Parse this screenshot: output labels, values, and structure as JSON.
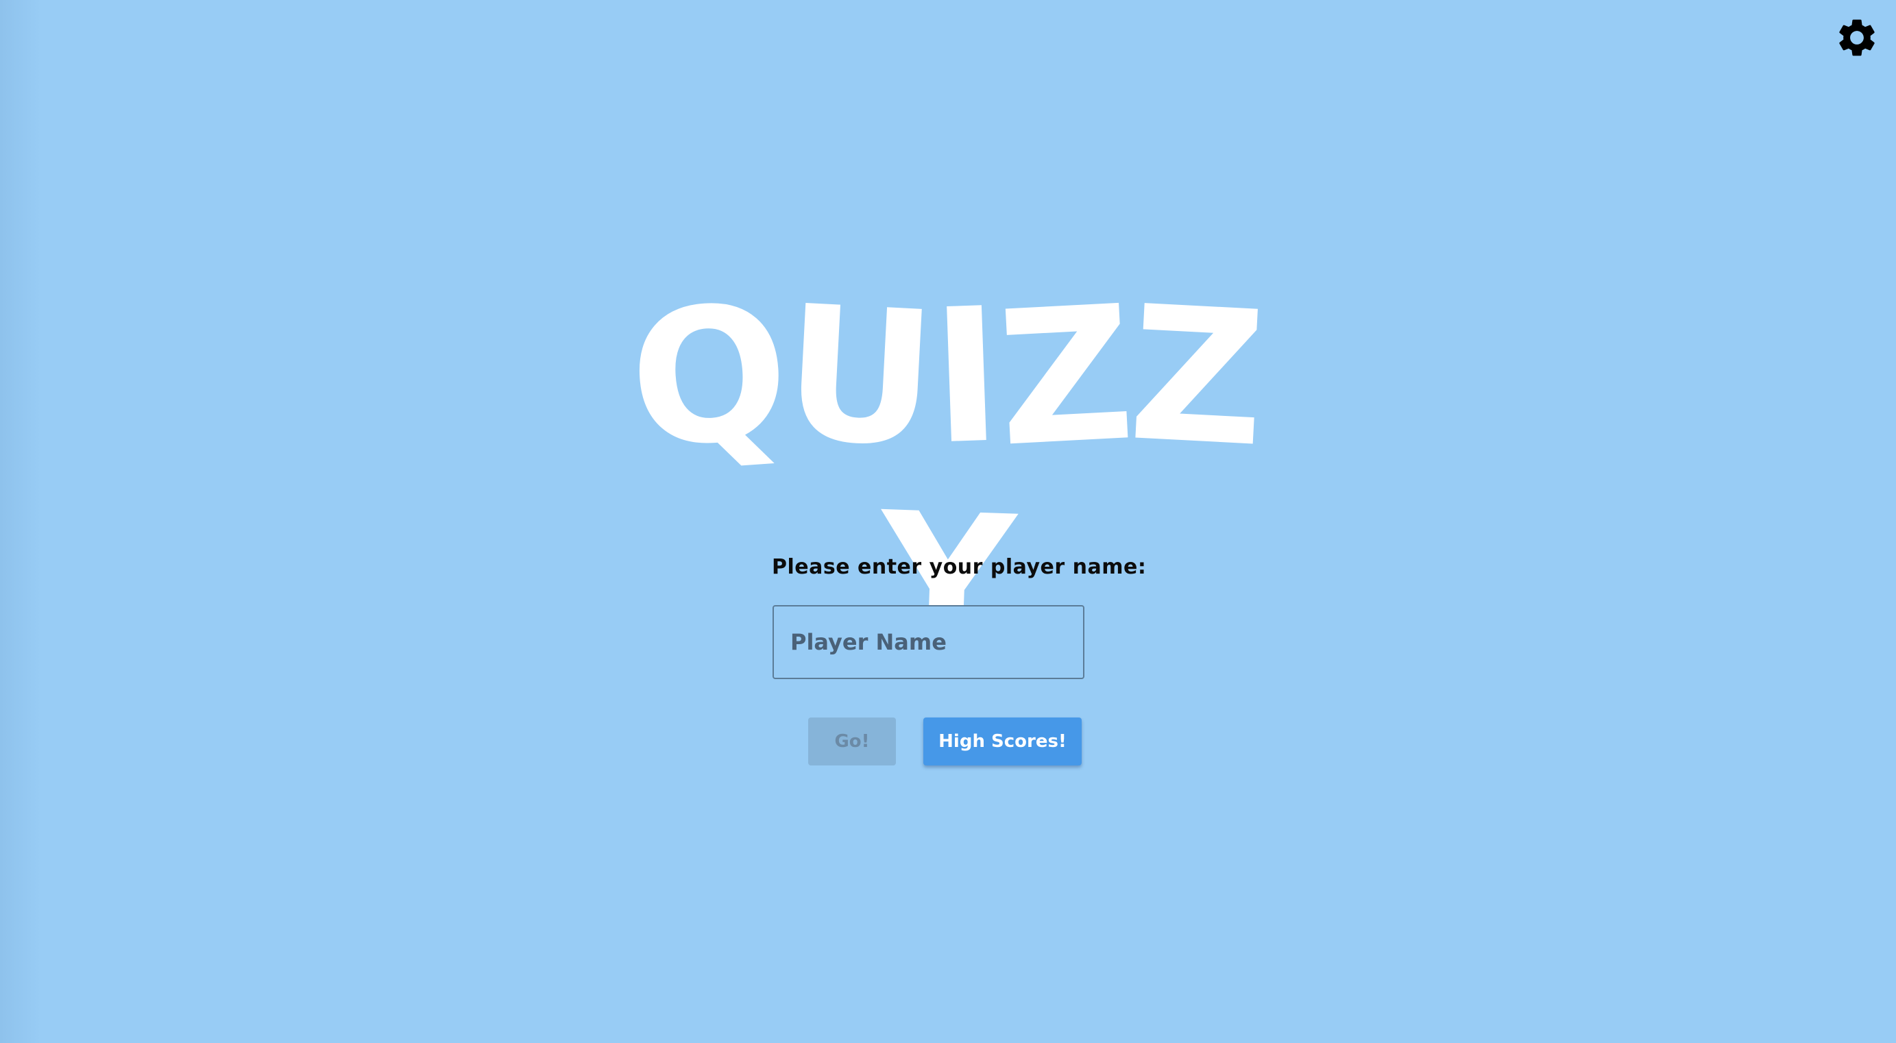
{
  "app": {
    "title_letters": [
      "Q",
      "U",
      "I",
      "Z",
      "Z",
      "Y"
    ]
  },
  "header": {
    "settings_icon": "gear-icon"
  },
  "form": {
    "prompt": "Please enter your player name:",
    "player_name": {
      "value": "",
      "placeholder": "Player Name"
    }
  },
  "actions": {
    "go_label": "Go!",
    "go_disabled": true,
    "high_scores_label": "High Scores!"
  },
  "colors": {
    "background": "#98ccf5",
    "primary_button": "#4698e8",
    "disabled_button": "#86b4d9",
    "title": "#ffffff"
  }
}
